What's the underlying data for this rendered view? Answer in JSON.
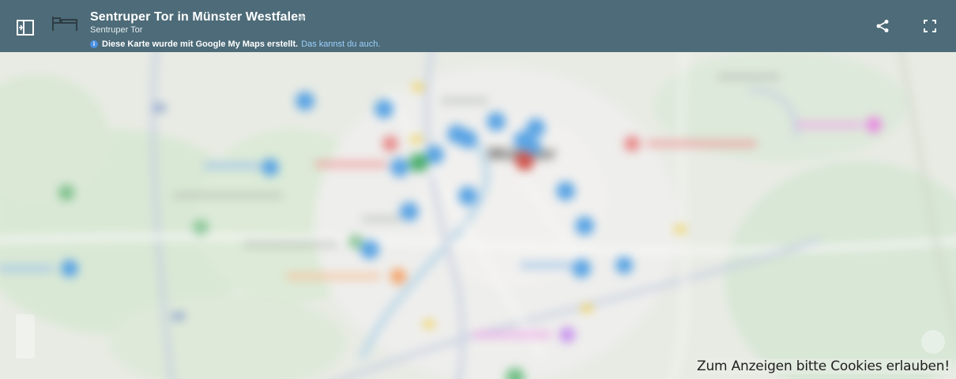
{
  "header": {
    "title": "Sentruper Tor in Münster Westfalen",
    "subtitle": "Sentruper Tor",
    "notice_text": "Diese Karte wurde mit Google My Maps erstellt.",
    "notice_link": "Das kannst du auch.",
    "info_icon_glyph": "i",
    "star_glyph": "★",
    "background_color": "#4d6b78"
  },
  "icons": {
    "panel": "side-panel-icon",
    "logo": "bed-icon",
    "share": "share-icon",
    "fullscreen": "fullscreen-icon"
  },
  "map": {
    "city_label": "Münster",
    "cookie_message": "Zum Anzeigen bitte Cookies erlauben!"
  }
}
